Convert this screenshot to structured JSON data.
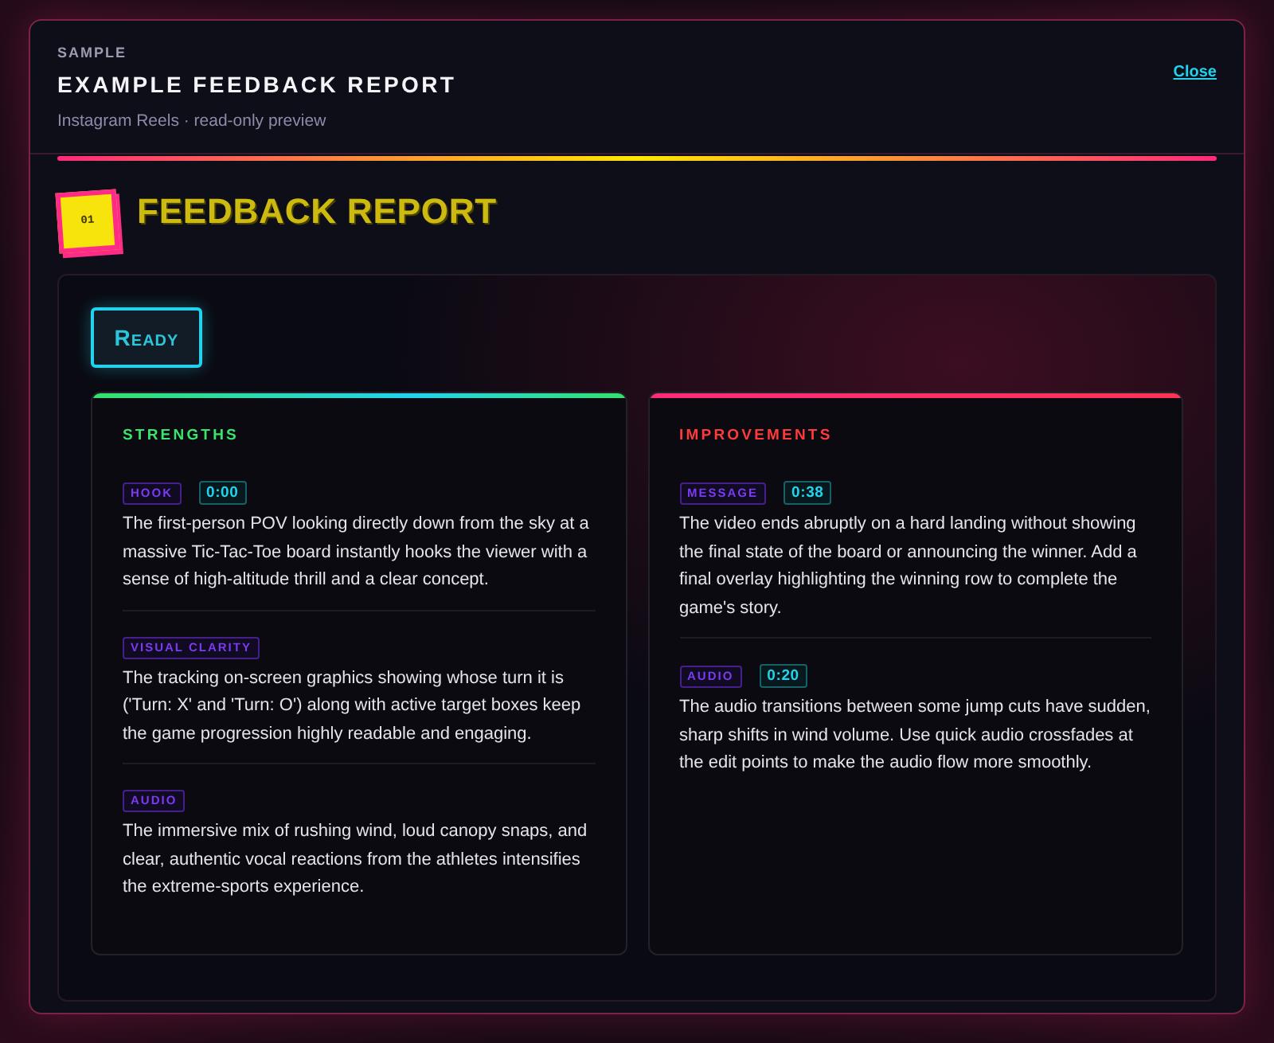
{
  "header": {
    "eyebrow": "SAMPLE",
    "title": "EXAMPLE FEEDBACK REPORT",
    "subtitle": "Instagram Reels · read-only preview",
    "close_link": "Close"
  },
  "section": {
    "number": "01",
    "title": "FEEDBACK REPORT"
  },
  "status_badge": "Ready",
  "columns": [
    {
      "kind": "strengths",
      "title": "STRENGTHS",
      "items": [
        {
          "tag": "HOOK",
          "timestamp": "0:00",
          "text": "The first-person POV looking directly down from the sky at a massive Tic-Tac-Toe board instantly hooks the viewer with a sense of high-altitude thrill and a clear concept."
        },
        {
          "tag": "VISUAL CLARITY",
          "text": "The tracking on-screen graphics showing whose turn it is ('Turn: X' and 'Turn: O') along with active target boxes keep the game progression highly readable and engaging."
        },
        {
          "tag": "AUDIO",
          "text": "The immersive mix of rushing wind, loud canopy snaps, and clear, authentic vocal reactions from the athletes intensifies the extreme-sports experience."
        }
      ]
    },
    {
      "kind": "improvements",
      "title": "IMPROVEMENTS",
      "items": [
        {
          "tag": "MESSAGE",
          "timestamp": "0:38",
          "text": "The video ends abruptly on a hard landing without showing the final state of the board or announcing the winner. Add a final overlay highlighting the winning row to complete the game's story."
        },
        {
          "tag": "AUDIO",
          "timestamp": "0:20",
          "text": "The audio transitions between some jump cuts have sudden, sharp shifts in wind volume. Use quick audio crossfades at the edit points to make the audio flow more smoothly."
        }
      ]
    }
  ]
}
